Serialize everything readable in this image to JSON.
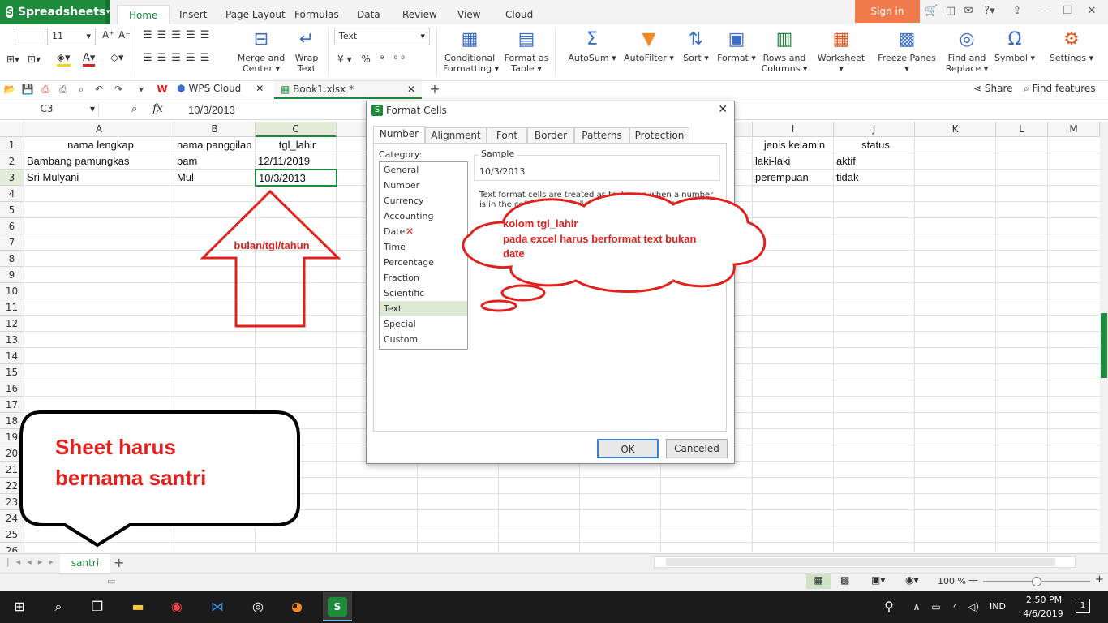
{
  "app": {
    "name": "Spreadsheets",
    "menu_tabs": [
      "Home",
      "Insert",
      "Page Layout",
      "Formulas",
      "Data",
      "Review",
      "View",
      "Cloud"
    ],
    "sign_in": "Sign in"
  },
  "ribbon": {
    "font_size": "11",
    "number_format": "Text",
    "buttons": {
      "merge": "Merge and\nCenter ▾",
      "wrap": "Wrap\nText",
      "cond": "Conditional\nFormatting ▾",
      "format_table": "Format as\nTable ▾",
      "autosum": "AutoSum ▾",
      "autofilter": "AutoFilter ▾",
      "sort": "Sort ▾",
      "format": "Format ▾",
      "rows_cols": "Rows and\nColumns ▾",
      "worksheet": "Worksheet ▾",
      "freeze": "Freeze Panes ▾",
      "find_replace": "Find and\nReplace ▾",
      "symbol": "Symbol ▾",
      "settings": "Settings ▾"
    }
  },
  "docbar": {
    "wps_cloud": "WPS Cloud",
    "doc_tab": "Book1.xlsx *",
    "share": "Share",
    "find_features": "Find features"
  },
  "formula_bar": {
    "cell_ref": "C3",
    "fx": "fx",
    "value": "10/3/2013"
  },
  "grid": {
    "columns": [
      "A",
      "B",
      "C",
      "D",
      "E",
      "F",
      "G",
      "H",
      "I",
      "J",
      "K",
      "L",
      "M"
    ],
    "rows": [
      "1",
      "2",
      "3",
      "4",
      "5",
      "6",
      "7",
      "8",
      "9",
      "10",
      "11",
      "12",
      "13",
      "14",
      "15",
      "16",
      "17",
      "18",
      "19",
      "20",
      "21",
      "22",
      "23",
      "24",
      "25",
      "26"
    ],
    "cells": {
      "a1": "nama lengkap",
      "b1": "nama panggilan",
      "c1": "tgl_lahir",
      "i1": "jenis kelamin",
      "j1": "status",
      "a2": "Bambang pamungkas",
      "b2": "bam",
      "c2": "12/11/2019",
      "i2": "laki-laki",
      "j2": "aktif",
      "a3": "Sri Mulyani",
      "b3": "Mul",
      "c3": "10/3/2013",
      "i3": "perempuan",
      "j3": "tidak"
    }
  },
  "dialog": {
    "title": "Format Cells",
    "tabs": [
      "Number",
      "Alignment",
      "Font",
      "Border",
      "Patterns",
      "Protection"
    ],
    "category_label": "Category:",
    "categories": [
      "General",
      "Number",
      "Currency",
      "Accounting",
      "Date",
      "Time",
      "Percentage",
      "Fraction",
      "Scientific",
      "Text",
      "Special",
      "Custom"
    ],
    "selected_category": "Text",
    "sample_label": "Sample",
    "sample_value": "10/3/2013",
    "description": "Text format cells are treated as text even when a number is in the cell. The cell is displayed exactly as entered.",
    "ok": "OK",
    "cancel": "Canceled"
  },
  "annotations": {
    "arrow_text": "bulan/tgl/tahun",
    "cloud_text_1": "kolom tgl_lahir",
    "cloud_text_2": "pada excel harus berformat text bukan",
    "cloud_text_3": "date",
    "bubble_line1": "Sheet harus",
    "bubble_line2": "bernama santri"
  },
  "sheetbar": {
    "sheet_tab": "santri",
    "add": "+"
  },
  "statusbar": {
    "zoom": "100 %"
  },
  "taskbar": {
    "lang": "IND",
    "time": "2:50 PM",
    "date": "4/6/2019",
    "notif_count": "1"
  },
  "colors": {
    "brand": "#1e8b3c",
    "annotation": "#e0211d",
    "signin": "#f07a4b"
  }
}
